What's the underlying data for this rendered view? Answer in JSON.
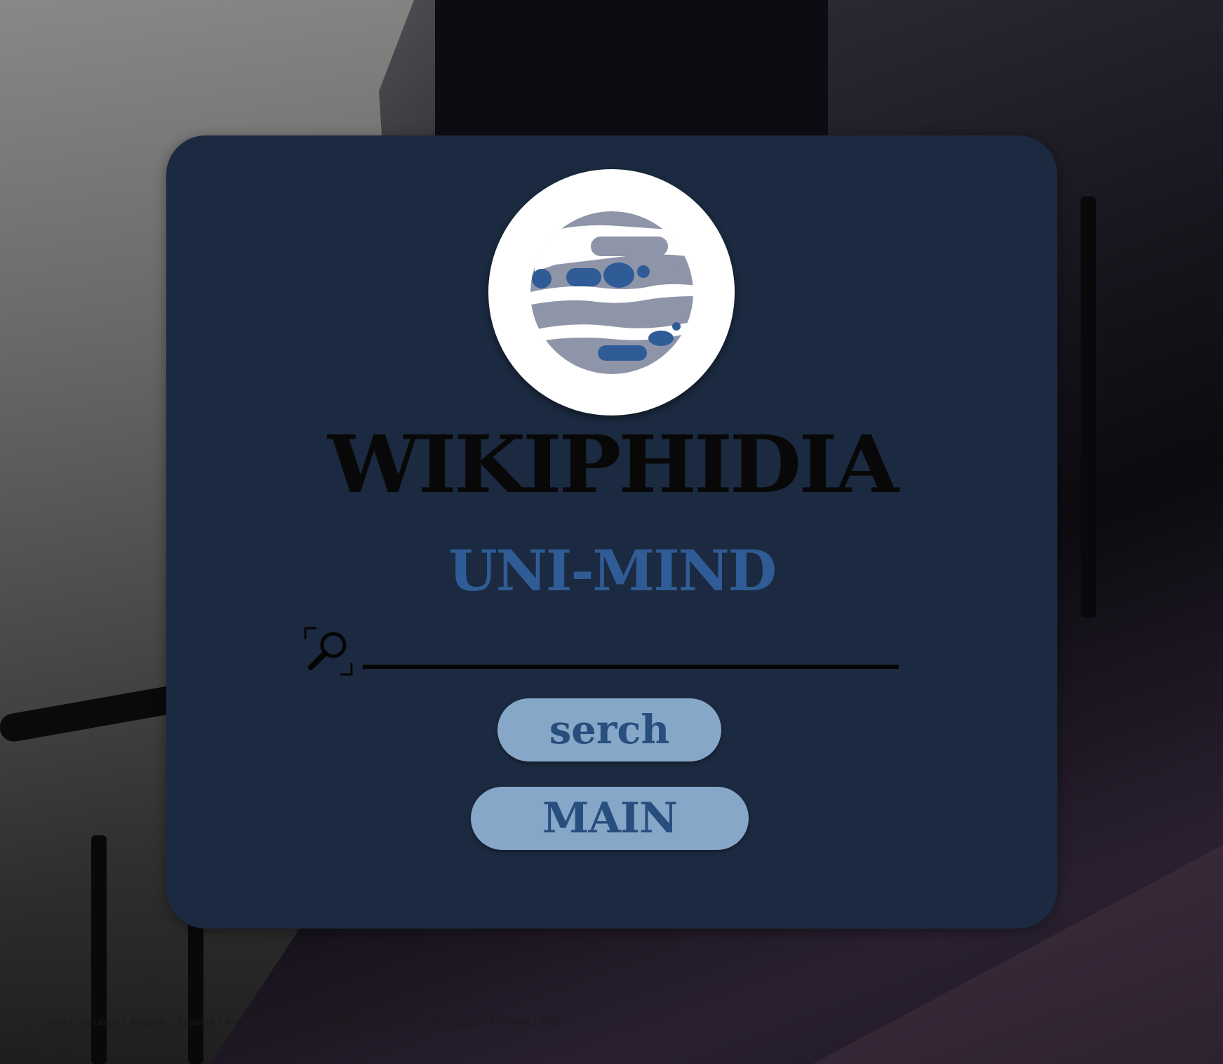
{
  "site": {
    "title": "WIKIPHIDIA",
    "subtitle": "UNI-MIND"
  },
  "search": {
    "value": "",
    "placeholder": ""
  },
  "buttons": {
    "search_label": "serch",
    "main_label": "MAIN"
  },
  "language_bar": {
    "prefix": "ภาษา:",
    "languages": [
      "Deutsch",
      "English",
      "Español",
      "Français",
      "Italiano",
      "日本語",
      "Nederlands",
      "Português",
      "Русский",
      "中文"
    ]
  },
  "colors": {
    "card": "#1b2a40",
    "subtitle": "#2f5c96",
    "button": "#87a7c8",
    "button_text": "#284e7e"
  },
  "icons": {
    "logo": "globe-icon",
    "search": "search-icon"
  }
}
